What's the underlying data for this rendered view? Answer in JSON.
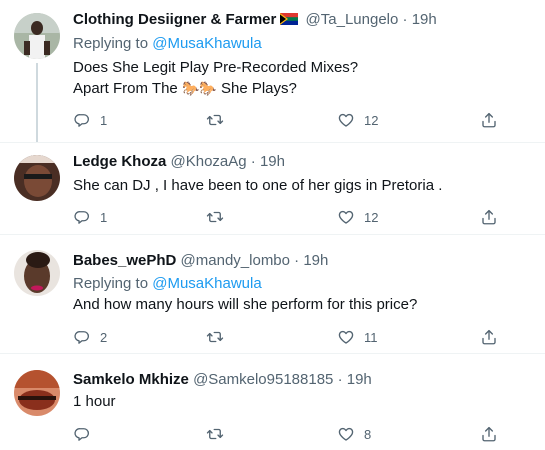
{
  "tweets": [
    {
      "name": "Clothing Desiigner & Farmer",
      "handle": "@Ta_Lungelo",
      "sep": "·",
      "time": "19h",
      "replying_prefix": "Replying to",
      "replying_handle": "@MusaKhawula",
      "text_line1": "Does She Legit Play Pre-Recorded Mixes?",
      "text_line2_pre": "Apart From The",
      "text_line2_emoji": "🐎🐎",
      "text_line2_post": "She Plays?",
      "replies": "1",
      "retweets": "",
      "likes": "12"
    },
    {
      "name": "Ledge Khoza",
      "handle": "@KhozaAg",
      "sep": "·",
      "time": "19h",
      "text_line1": "She can DJ , I have been to one of her gigs in Pretoria .",
      "replies": "1",
      "retweets": "",
      "likes": "12"
    },
    {
      "name": "Babes_wePhD",
      "handle": "@mandy_lombo",
      "sep": "·",
      "time": "19h",
      "replying_prefix": "Replying to",
      "replying_handle": "@MusaKhawula",
      "text_line1": "And how many hours will she perform for this price?",
      "replies": "2",
      "retweets": "",
      "likes": "11"
    },
    {
      "name": "Samkelo Mkhize",
      "handle": "@Samkelo95188185",
      "sep": "·",
      "time": "19h",
      "text_line1": "1 hour",
      "replies": "",
      "retweets": "",
      "likes": "8"
    }
  ],
  "icons": {
    "reply": "reply-icon",
    "retweet": "retweet-icon",
    "like": "heart-icon",
    "share": "share-icon"
  },
  "colors": {
    "link": "#1d9bf0",
    "muted": "#536471",
    "divider": "#eff3f4",
    "thread_line": "#cfd9de"
  }
}
